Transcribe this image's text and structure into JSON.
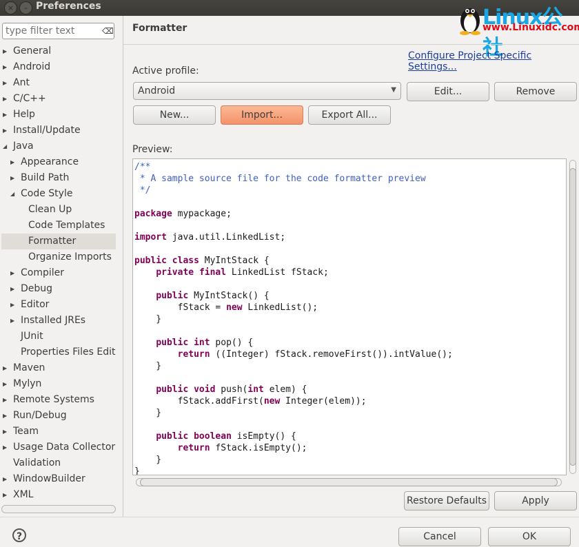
{
  "window": {
    "title": "Preferences",
    "close_glyph": "×",
    "minimize_glyph": "–"
  },
  "watermark": {
    "brand": "Linux公社",
    "url": "www.Linuxidc.com"
  },
  "filter": {
    "placeholder": "type filter text",
    "clear_glyph": "⌫"
  },
  "tree": [
    {
      "label": "General",
      "depth": 0,
      "arrow": "right"
    },
    {
      "label": "Android",
      "depth": 0,
      "arrow": "right"
    },
    {
      "label": "Ant",
      "depth": 0,
      "arrow": "right"
    },
    {
      "label": "C/C++",
      "depth": 0,
      "arrow": "right"
    },
    {
      "label": "Help",
      "depth": 0,
      "arrow": "right"
    },
    {
      "label": "Install/Update",
      "depth": 0,
      "arrow": "right"
    },
    {
      "label": "Java",
      "depth": 0,
      "arrow": "down"
    },
    {
      "label": "Appearance",
      "depth": 1,
      "arrow": "right"
    },
    {
      "label": "Build Path",
      "depth": 1,
      "arrow": "right"
    },
    {
      "label": "Code Style",
      "depth": 1,
      "arrow": "down"
    },
    {
      "label": "Clean Up",
      "depth": 2,
      "arrow": "none"
    },
    {
      "label": "Code Templates",
      "depth": 2,
      "arrow": "none"
    },
    {
      "label": "Formatter",
      "depth": 2,
      "arrow": "none",
      "selected": true
    },
    {
      "label": "Organize Imports",
      "depth": 2,
      "arrow": "none"
    },
    {
      "label": "Compiler",
      "depth": 1,
      "arrow": "right"
    },
    {
      "label": "Debug",
      "depth": 1,
      "arrow": "right"
    },
    {
      "label": "Editor",
      "depth": 1,
      "arrow": "right"
    },
    {
      "label": "Installed JREs",
      "depth": 1,
      "arrow": "right"
    },
    {
      "label": "JUnit",
      "depth": 1,
      "arrow": "none"
    },
    {
      "label": "Properties Files Edito",
      "depth": 1,
      "arrow": "none"
    },
    {
      "label": "Maven",
      "depth": 0,
      "arrow": "right"
    },
    {
      "label": "Mylyn",
      "depth": 0,
      "arrow": "right"
    },
    {
      "label": "Remote Systems",
      "depth": 0,
      "arrow": "right"
    },
    {
      "label": "Run/Debug",
      "depth": 0,
      "arrow": "right"
    },
    {
      "label": "Team",
      "depth": 0,
      "arrow": "right"
    },
    {
      "label": "Usage Data Collector",
      "depth": 0,
      "arrow": "right"
    },
    {
      "label": "Validation",
      "depth": 0,
      "arrow": "none"
    },
    {
      "label": "WindowBuilder",
      "depth": 0,
      "arrow": "right"
    },
    {
      "label": "XML",
      "depth": 0,
      "arrow": "right"
    }
  ],
  "page": {
    "title": "Formatter",
    "config_link": "Configure Project Specific Settings...",
    "active_profile_label": "Active profile:",
    "profile_value": "Android",
    "edit_label": "Edit...",
    "remove_label": "Remove",
    "new_label": "New...",
    "import_label": "Import...",
    "export_all_label": "Export All...",
    "preview_label": "Preview:"
  },
  "preview_code": [
    [
      [
        "cm",
        "/**"
      ]
    ],
    [
      [
        "cm",
        " * A sample source file for the code formatter preview"
      ]
    ],
    [
      [
        "cm",
        " */"
      ]
    ],
    [],
    [
      [
        "kw",
        "package"
      ],
      [
        "",
        " mypackage;"
      ]
    ],
    [],
    [
      [
        "kw",
        "import"
      ],
      [
        "",
        " java.util.LinkedList;"
      ]
    ],
    [],
    [
      [
        "kw",
        "public"
      ],
      [
        "",
        " "
      ],
      [
        "kw",
        "class"
      ],
      [
        "",
        " MyIntStack {"
      ]
    ],
    [
      [
        "",
        "    "
      ],
      [
        "kw",
        "private"
      ],
      [
        "",
        " "
      ],
      [
        "kw",
        "final"
      ],
      [
        "",
        " LinkedList fStack;"
      ]
    ],
    [],
    [
      [
        "",
        "    "
      ],
      [
        "kw",
        "public"
      ],
      [
        "",
        " MyIntStack() {"
      ]
    ],
    [
      [
        "",
        "        fStack = "
      ],
      [
        "kw",
        "new"
      ],
      [
        "",
        " LinkedList();"
      ]
    ],
    [
      [
        "",
        "    }"
      ]
    ],
    [],
    [
      [
        "",
        "    "
      ],
      [
        "kw",
        "public"
      ],
      [
        "",
        " "
      ],
      [
        "kw",
        "int"
      ],
      [
        "",
        " pop() {"
      ]
    ],
    [
      [
        "",
        "        "
      ],
      [
        "kw",
        "return"
      ],
      [
        "",
        " ((Integer) fStack.removeFirst()).intValue();"
      ]
    ],
    [
      [
        "",
        "    }"
      ]
    ],
    [],
    [
      [
        "",
        "    "
      ],
      [
        "kw",
        "public"
      ],
      [
        "",
        " "
      ],
      [
        "kw",
        "void"
      ],
      [
        "",
        " push("
      ],
      [
        "kw",
        "int"
      ],
      [
        "",
        " elem) {"
      ]
    ],
    [
      [
        "",
        "        fStack.addFirst("
      ],
      [
        "kw",
        "new"
      ],
      [
        "",
        " Integer(elem));"
      ]
    ],
    [
      [
        "",
        "    }"
      ]
    ],
    [],
    [
      [
        "",
        "    "
      ],
      [
        "kw",
        "public"
      ],
      [
        "",
        " "
      ],
      [
        "kw",
        "boolean"
      ],
      [
        "",
        " isEmpty() {"
      ]
    ],
    [
      [
        "",
        "        "
      ],
      [
        "kw",
        "return"
      ],
      [
        "",
        " fStack.isEmpty();"
      ]
    ],
    [
      [
        "",
        "    }"
      ]
    ],
    [
      [
        "",
        "}"
      ]
    ]
  ],
  "footer": {
    "restore_defaults_label": "Restore Defaults",
    "apply_label": "Apply",
    "cancel_label": "Cancel",
    "ok_label": "OK",
    "help_glyph": "?"
  },
  "icons": {
    "tree_expand": "▶",
    "tree_collapse": "◢",
    "combo_dropdown": "▼"
  }
}
